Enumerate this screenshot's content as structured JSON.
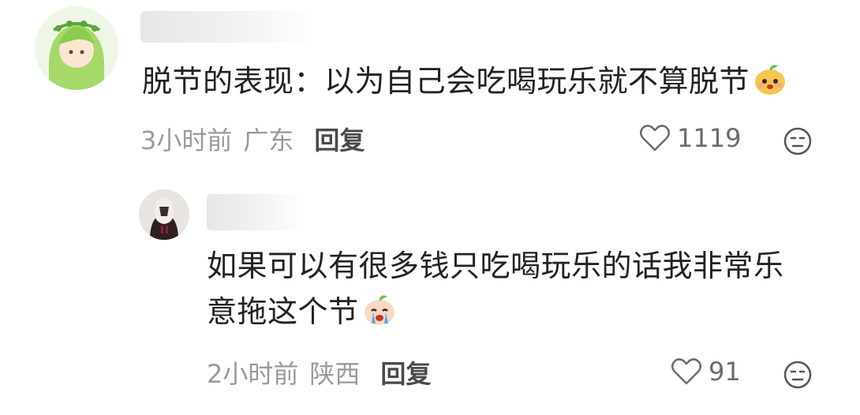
{
  "comment": {
    "text": "脱节的表现：以为自己会吃喝玩乐就不算脱节",
    "time": "3小时前",
    "location": "广东",
    "reply_label": "回复",
    "likes": "1119",
    "emoji": "smiling-face-emoji"
  },
  "reply": {
    "text_line1": "如果可以有很多钱只吃喝玩乐的话我非常乐",
    "text_line2": "意拖这个节",
    "time": "2小时前",
    "location": "陕西",
    "reply_label": "回复",
    "likes": "91",
    "emoji": "crying-face-emoji"
  },
  "colors": {
    "text": "#222222",
    "meta": "#9a9a9a",
    "emoji_fill": "#f8c550",
    "emoji_leaf": "#6bbf4a"
  }
}
